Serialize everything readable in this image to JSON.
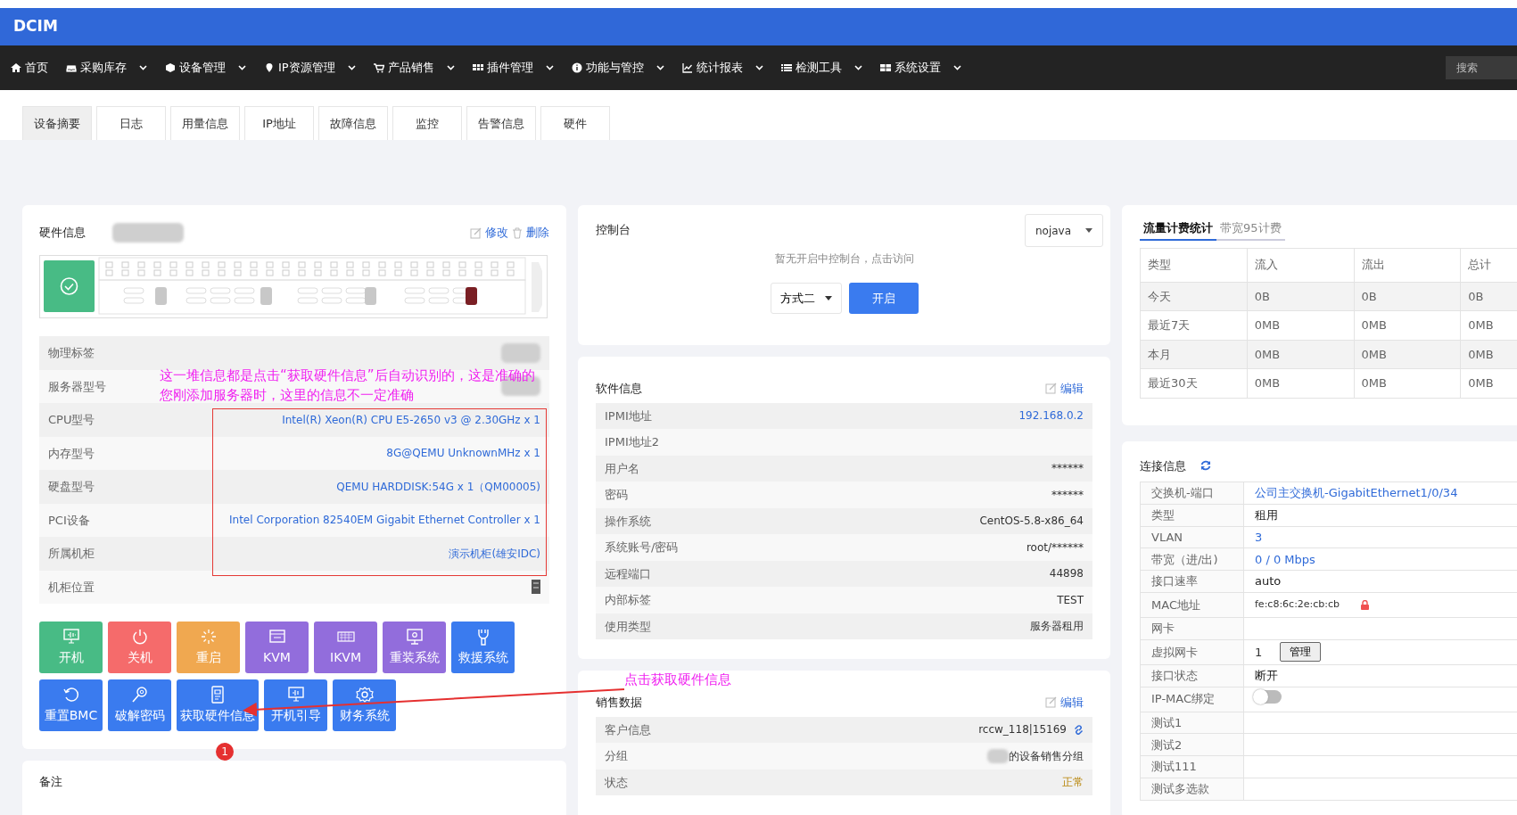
{
  "brand": "DCIM",
  "nav": [
    {
      "label": "首页",
      "caret": false
    },
    {
      "label": "采购库存",
      "caret": true
    },
    {
      "label": "设备管理",
      "caret": true
    },
    {
      "label": "IP资源管理",
      "caret": true
    },
    {
      "label": "产品销售",
      "caret": true
    },
    {
      "label": "插件管理",
      "caret": true
    },
    {
      "label": "功能与管控",
      "caret": true
    },
    {
      "label": "统计报表",
      "caret": true
    },
    {
      "label": "检测工具",
      "caret": true
    },
    {
      "label": "系统设置",
      "caret": true
    }
  ],
  "search": {
    "placeholder": "搜索"
  },
  "tabs": [
    {
      "label": "设备摘要",
      "selected": true
    },
    {
      "label": "日志",
      "selected": false
    },
    {
      "label": "用量信息",
      "selected": false
    },
    {
      "label": "IP地址",
      "selected": false
    },
    {
      "label": "故障信息",
      "selected": false
    },
    {
      "label": "监控",
      "selected": false
    },
    {
      "label": "告警信息",
      "selected": false
    },
    {
      "label": "硬件",
      "selected": false
    }
  ],
  "hardware": {
    "title": "硬件信息",
    "edit": "修改",
    "delete": "删除",
    "rows": [
      {
        "label": "物理标签",
        "kind": "blurred"
      },
      {
        "label": "服务器型号",
        "kind": "blurred"
      },
      {
        "label": "CPU型号",
        "kind": "link",
        "value": "Intel(R) Xeon(R) CPU E5-2650 v3 @ 2.30GHz x 1"
      },
      {
        "label": "内存型号",
        "kind": "link",
        "value": "8G@QEMU UnknownMHz x 1"
      },
      {
        "label": "硬盘型号",
        "kind": "link",
        "value": "QEMU HARDDISK:54G x 1（QM00005)"
      },
      {
        "label": "PCI设备",
        "kind": "link",
        "value": "Intel Corporation 82540EM Gigabit Ethernet Controller x 1"
      },
      {
        "label": "所属机柜",
        "kind": "link",
        "value": "演示机柜(雄安IDC)"
      },
      {
        "label": "机柜位置",
        "kind": "icon"
      }
    ],
    "buttons": [
      [
        {
          "label": "开机",
          "color": "#48bb85"
        },
        {
          "label": "关机",
          "color": "#f56b6b"
        },
        {
          "label": "重启",
          "color": "#f0a850"
        },
        {
          "label": "KVM",
          "color": "#926ddc"
        },
        {
          "label": "IKVM",
          "color": "#926ddc"
        },
        {
          "label": "重装系统",
          "color": "#926ddc"
        },
        {
          "label": "救援系统",
          "color": "#3a7bef"
        }
      ],
      [
        {
          "label": "重置BMC",
          "color": "#3a7bef"
        },
        {
          "label": "破解密码",
          "color": "#3a7bef"
        },
        {
          "label": "获取硬件信息",
          "color": "#3a7bef"
        },
        {
          "label": "开机引导",
          "color": "#3a7bef"
        },
        {
          "label": "财务系统",
          "color": "#3a7bef"
        }
      ]
    ]
  },
  "remark": {
    "title": "备注"
  },
  "console": {
    "title": "控制台",
    "mode": "nojava",
    "message": "暂无开启中控制台，点击访问",
    "method": "方式二",
    "open": "开启"
  },
  "software": {
    "title": "软件信息",
    "edit": "编辑",
    "rows": [
      {
        "label": "IPMI地址",
        "value": "192.168.0.2",
        "kind": "link"
      },
      {
        "label": "IPMI地址2",
        "kind": "empty"
      },
      {
        "label": "用户名",
        "value": "******",
        "kind": "text"
      },
      {
        "label": "密码",
        "value": "******",
        "kind": "text"
      },
      {
        "label": "操作系统",
        "value": "CentOS-5.8-x86_64",
        "kind": "text"
      },
      {
        "label": "系统账号/密码",
        "value": "root/******",
        "kind": "text"
      },
      {
        "label": "远程端口",
        "value": "44898",
        "kind": "text"
      },
      {
        "label": "内部标签",
        "value": "TEST",
        "kind": "text"
      },
      {
        "label": "使用类型",
        "value": "服务器租用",
        "kind": "text"
      }
    ]
  },
  "sales": {
    "title": "销售数据",
    "edit": "编辑",
    "rows": [
      {
        "label": "客户信息",
        "value": "rccw_118|15169",
        "kind": "linked"
      },
      {
        "label": "分组",
        "value": "的设备销售分组",
        "kind": "blurred"
      },
      {
        "label": "状态",
        "value": "正常",
        "kind": "status"
      }
    ]
  },
  "traffic": {
    "tabs": [
      {
        "label": "流量计费统计",
        "selected": true
      },
      {
        "label": "带宽95计费",
        "selected": false
      }
    ],
    "columns": [
      "类型",
      "流入",
      "流出",
      "总计"
    ],
    "rows": [
      [
        "今天",
        "0B",
        "0B",
        "0B"
      ],
      [
        "最近7天",
        "0MB",
        "0MB",
        "0MB"
      ],
      [
        "本月",
        "0MB",
        "0MB",
        "0MB"
      ],
      [
        "最近30天",
        "0MB",
        "0MB",
        "0MB"
      ]
    ]
  },
  "connection": {
    "title": "连接信息",
    "rows": [
      {
        "label": "交换机-端口",
        "value": "公司主交换机-GigabitEthernet1/0/34",
        "kind": "link"
      },
      {
        "label": "类型",
        "value": "租用",
        "kind": "text"
      },
      {
        "label": "VLAN",
        "value": "3",
        "kind": "link"
      },
      {
        "label": "带宽（进/出)",
        "value": "0 / 0 Mbps",
        "kind": "link"
      },
      {
        "label": "接口速率",
        "value": "auto",
        "kind": "text"
      },
      {
        "label": "MAC地址",
        "value": "fe:c8:6c:2e:cb:cb",
        "kind": "mac"
      },
      {
        "label": "网卡",
        "kind": "empty"
      },
      {
        "label": "虚拟网卡",
        "value": "1",
        "kind": "vnic",
        "button": "管理"
      },
      {
        "label": "接口状态",
        "value": "断开",
        "kind": "text"
      },
      {
        "label": "IP-MAC绑定",
        "kind": "toggle",
        "on": false
      },
      {
        "label": "测试1",
        "kind": "empty"
      },
      {
        "label": "测试2",
        "kind": "empty"
      },
      {
        "label": "测试111",
        "kind": "empty"
      },
      {
        "label": "测试多选款",
        "kind": "empty"
      }
    ]
  },
  "annotations": {
    "note_lines": [
      "这一堆信息都是点击“获取硬件信息”后自动识别的，这是准确的",
      "您刚添加服务器时，这里的信息不一定准确"
    ],
    "hint": "点击获取硬件信息",
    "step": "1"
  }
}
